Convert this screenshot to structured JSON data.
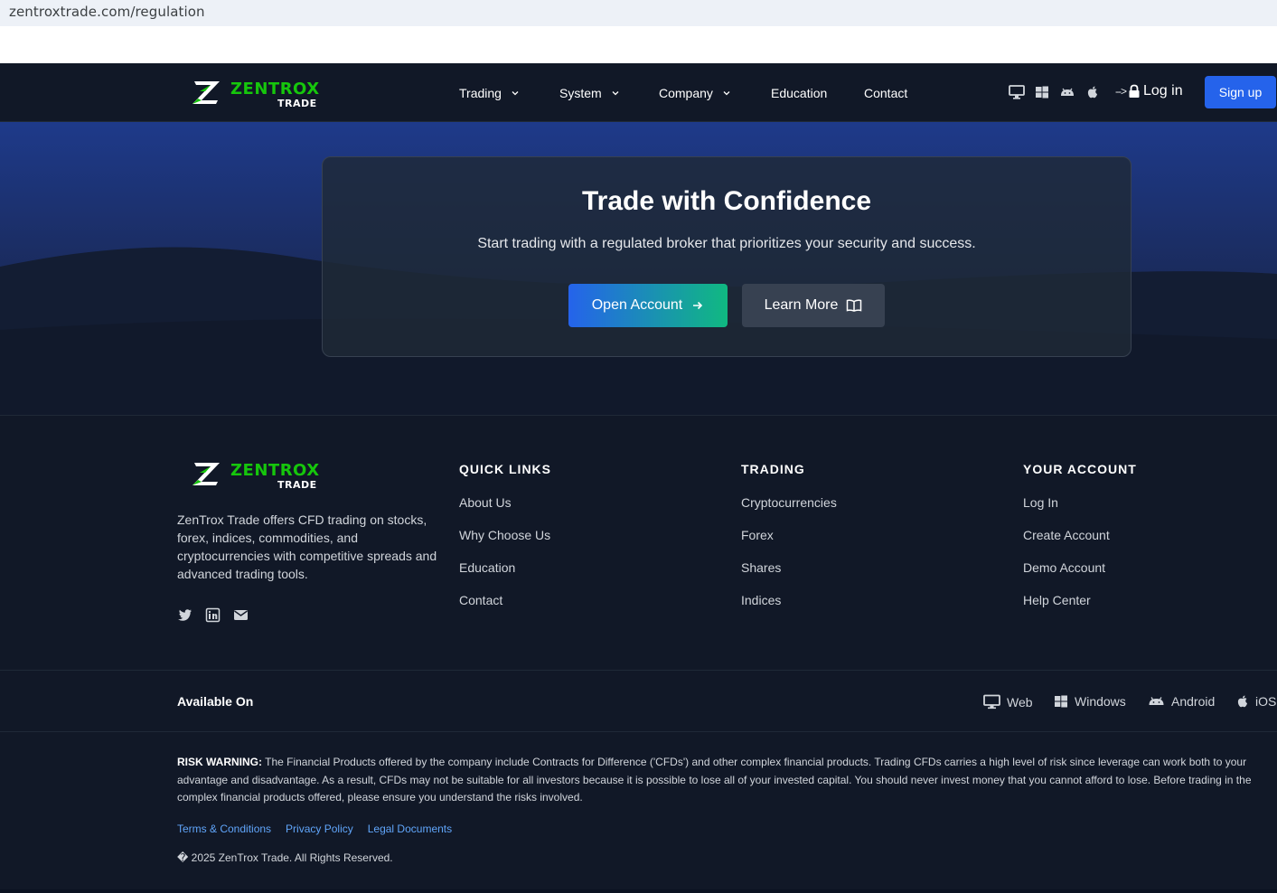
{
  "browser": {
    "url": "zentroxtrade.com/regulation"
  },
  "brand": {
    "name": "ZENTROX",
    "sub": "TRADE",
    "green": "#16c60c"
  },
  "nav": {
    "items": [
      {
        "label": "Trading",
        "dropdown": true
      },
      {
        "label": "System",
        "dropdown": true
      },
      {
        "label": "Company",
        "dropdown": true
      },
      {
        "label": "Education",
        "dropdown": false
      },
      {
        "label": "Contact",
        "dropdown": false
      }
    ],
    "platform_icons": [
      "desktop-icon",
      "windows-icon",
      "android-icon",
      "apple-icon"
    ],
    "login_arrow": "-->",
    "login_label": "Log in",
    "signup_label": "Sign up"
  },
  "hero": {
    "title": "Trade with Confidence",
    "subtitle": "Start trading with a regulated broker that prioritizes your security and success.",
    "open_account": "Open Account",
    "learn_more": "Learn More"
  },
  "footer": {
    "description": "ZenTrox Trade offers CFD trading on stocks, forex, indices, commodities, and cryptocurrencies with competitive spreads and advanced trading tools.",
    "socials": [
      "twitter-icon",
      "linkedin-icon",
      "envelope-icon"
    ],
    "columns": [
      {
        "title": "QUICK LINKS",
        "links": [
          "About Us",
          "Why Choose Us",
          "Education",
          "Contact"
        ]
      },
      {
        "title": "TRADING",
        "links": [
          "Cryptocurrencies",
          "Forex",
          "Shares",
          "Indices"
        ]
      },
      {
        "title": "YOUR ACCOUNT",
        "links": [
          "Log In",
          "Create Account",
          "Demo Account",
          "Help Center"
        ]
      }
    ],
    "available_on": "Available On",
    "platforms": [
      "Web",
      "Windows",
      "Android",
      "iOS"
    ],
    "risk_label": "RISK WARNING:",
    "risk_text": " The Financial Products offered by the company include Contracts for Difference ('CFDs') and other complex financial products. Trading CFDs carries a high level of risk since leverage can work both to your advantage and disadvantage. As a result, CFDs may not be suitable for all investors because it is possible to lose all of your invested capital. You should never invest money that you cannot afford to lose. Before trading in the complex financial products offered, please ensure you understand the risks involved.",
    "legal_links": [
      "Terms & Conditions",
      "Privacy Policy",
      "Legal Documents"
    ],
    "copyright": "� 2025 ZenTrox Trade. All Rights Reserved."
  },
  "colors": {
    "bg": "#111827",
    "primary": "#2563eb",
    "accent": "#10b981",
    "link": "#60a5fa"
  }
}
